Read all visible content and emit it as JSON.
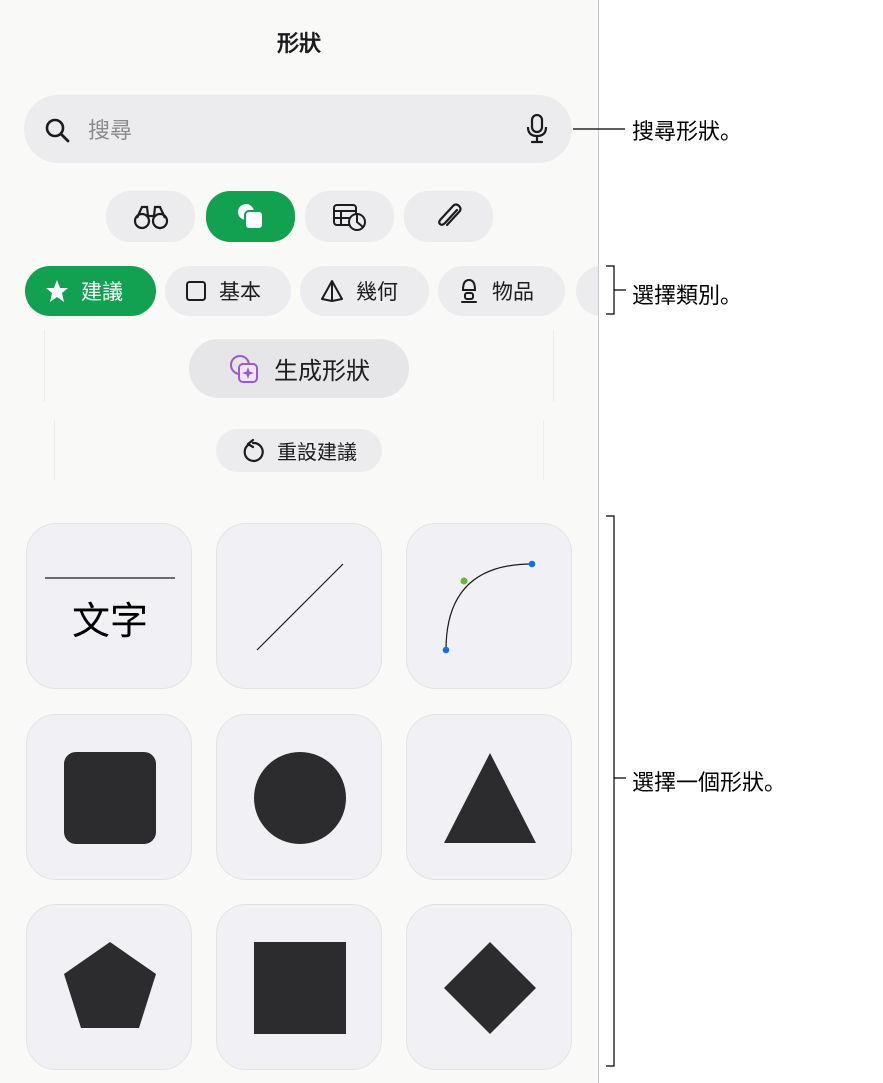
{
  "panel": {
    "title": "形狀",
    "search": {
      "placeholder": "搜尋",
      "icon": "magnifying-glass-icon",
      "mic_icon": "microphone-icon"
    },
    "source_tabs": [
      {
        "icon": "binoculars-icon",
        "active": false
      },
      {
        "icon": "shapes-icon",
        "active": true
      },
      {
        "icon": "table-chart-icon",
        "active": false
      },
      {
        "icon": "paperclip-icon",
        "active": false
      }
    ],
    "categories": [
      {
        "label": "建議",
        "icon": "star-icon",
        "active": true
      },
      {
        "label": "基本",
        "icon": "square-icon",
        "active": false
      },
      {
        "label": "幾何",
        "icon": "pyramid-icon",
        "active": false
      },
      {
        "label": "物品",
        "icon": "lamp-icon",
        "active": false
      }
    ],
    "generate_label": "生成形狀",
    "reset_label": "重設建議",
    "shapes": [
      {
        "name": "text",
        "label": "文字"
      },
      {
        "name": "line"
      },
      {
        "name": "curve"
      },
      {
        "name": "rounded-square"
      },
      {
        "name": "circle"
      },
      {
        "name": "triangle"
      },
      {
        "name": "pentagon"
      },
      {
        "name": "square"
      },
      {
        "name": "diamond"
      }
    ]
  },
  "callouts": {
    "search": "搜尋形狀。",
    "category": "選擇類別。",
    "shape": "選擇一個形狀。"
  },
  "colors": {
    "accent": "#12a150",
    "shape_fill": "#2c2c2e",
    "handle_blue": "#1a6fe0",
    "handle_green": "#6db33f"
  }
}
